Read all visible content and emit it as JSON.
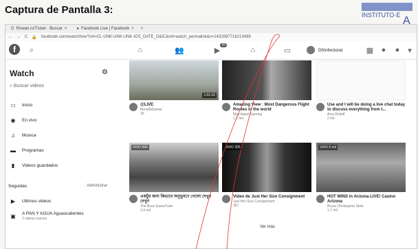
{
  "caption": "Captura de Pantalla 3:",
  "stamp": {
    "text": "INSTITUTO·E",
    "sub": "A"
  },
  "browser": {
    "tabs": [
      {
        "label": "Rowan.ro/Ticket · Buscar"
      },
      {
        "label": "Facebook Live | Facebook"
      }
    ],
    "url": "facebook.com/watch/live/?ref=CL-UNK-UNK-UNK-IOS_DATE_D&IC&ref=watch_permalink&v=1432087716213499"
  },
  "sidebar": {
    "title": "Watch",
    "search_placeholder": "Buscar videos",
    "items": [
      {
        "label": "Inicio",
        "icon": "tv-icon"
      },
      {
        "label": "En vivo",
        "icon": "live-icon"
      },
      {
        "label": "Musica",
        "icon": "music-icon"
      },
      {
        "label": "Programas",
        "icon": "shows-icon"
      },
      {
        "label": "Videos guardados",
        "icon": "bookmark-icon"
      }
    ],
    "following_label": "Seguidas",
    "manage_label": "Administrar",
    "following": [
      {
        "label": "Ultimos videos"
      },
      {
        "label": "A PAN Y AGUA Aguascalientes",
        "sub": "2 videos nuevos"
      }
    ]
  },
  "main": {
    "user": "Dfrinfectoral",
    "badge": "20",
    "cards": [
      {
        "title": "@LIVE",
        "channel": "BenellaGamer",
        "views": "30",
        "duration": "1:01:32",
        "live": ""
      },
      {
        "title": "Amazing View : Most Dangerous Flight Routes in the world",
        "channel": "Mas Aquel Gaming",
        "views": "1.7 mil",
        "duration": "",
        "live": ""
      },
      {
        "title": "Use and I will be doing a live chat today to discuss everything from t...",
        "channel": "Amy Rolloff",
        "views": "2 mil",
        "duration": "",
        "live": ""
      },
      {
        "title": "একটুর জন্য কিভাবে অনুভূমণে গেলো দেখুন দেখুন",
        "channel": "The Boss GameTube",
        "views": "3.4 mil",
        "duration": "",
        "live": "VIVO 590"
      },
      {
        "title": "Video de Just Her Size Consignment",
        "channel": "Just Her Size Consignment",
        "views": "357",
        "duration": "",
        "live": "VIVO 325"
      },
      {
        "title": "HOT WINS in Arizona LIVE! Casino Arizona",
        "channel": "Bruce Christopher Slots",
        "views": "1.7 mil",
        "duration": "",
        "live": "VIVO 5 mil"
      }
    ],
    "more_label": "Ver más"
  }
}
